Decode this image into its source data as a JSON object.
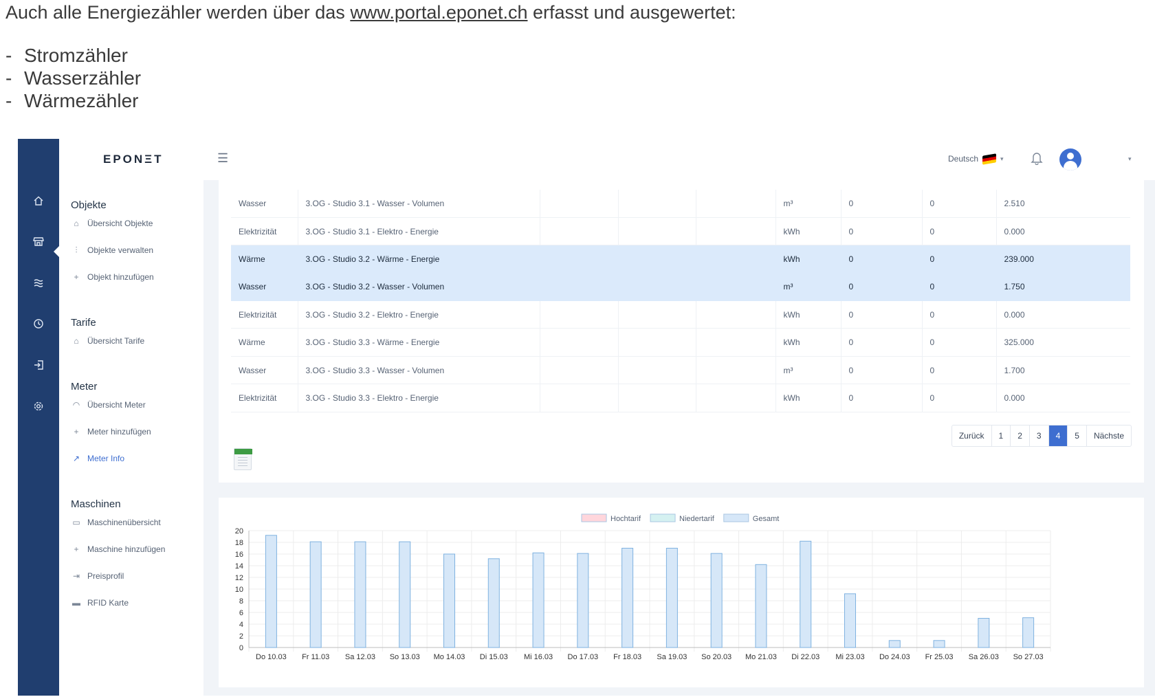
{
  "intro": {
    "text_before": "Auch alle Energiezähler werden über das ",
    "link": "www.portal.eponet.ch",
    "text_after": " erfasst und ausgewertet:",
    "bullets": [
      "Stromzähler",
      "Wasserzähler",
      "Wärmezähler"
    ],
    "dash": "-"
  },
  "brand": {
    "logo": "EPONΞT"
  },
  "topbar": {
    "language": "Deutsch"
  },
  "sidebar": {
    "objekte": {
      "title": "Objekte",
      "items": [
        "Übersicht Objekte",
        "Objekte verwalten",
        "Objekt hinzufügen"
      ]
    },
    "tarife": {
      "title": "Tarife",
      "items": [
        "Übersicht Tarife"
      ]
    },
    "meter": {
      "title": "Meter",
      "items": [
        "Übersicht Meter",
        "Meter hinzufügen",
        "Meter Info"
      ]
    },
    "maschinen": {
      "title": "Maschinen",
      "items": [
        "Maschinenübersicht",
        "Maschine hinzufügen",
        "Preisprofil",
        "RFID Karte"
      ]
    }
  },
  "table": {
    "rows": [
      {
        "type": "Wasser",
        "name": "3.OG - Studio 3.1 - Wasser - Volumen",
        "unit": "m³",
        "v1": "0",
        "v2": "0",
        "v3": "2.510",
        "highlight": false
      },
      {
        "type": "Elektrizität",
        "name": "3.OG - Studio 3.1 - Elektro - Energie",
        "unit": "kWh",
        "v1": "0",
        "v2": "0",
        "v3": "0.000",
        "highlight": false
      },
      {
        "type": "Wärme",
        "name": "3.OG - Studio 3.2 - Wärme - Energie",
        "unit": "kWh",
        "v1": "0",
        "v2": "0",
        "v3": "239.000",
        "highlight": true
      },
      {
        "type": "Wasser",
        "name": "3.OG - Studio 3.2 - Wasser - Volumen",
        "unit": "m³",
        "v1": "0",
        "v2": "0",
        "v3": "1.750",
        "highlight": true
      },
      {
        "type": "Elektrizität",
        "name": "3.OG - Studio 3.2 - Elektro - Energie",
        "unit": "kWh",
        "v1": "0",
        "v2": "0",
        "v3": "0.000",
        "highlight": false
      },
      {
        "type": "Wärme",
        "name": "3.OG - Studio 3.3 - Wärme - Energie",
        "unit": "kWh",
        "v1": "0",
        "v2": "0",
        "v3": "325.000",
        "highlight": false
      },
      {
        "type": "Wasser",
        "name": "3.OG - Studio 3.3 - Wasser - Volumen",
        "unit": "m³",
        "v1": "0",
        "v2": "0",
        "v3": "1.700",
        "highlight": false
      },
      {
        "type": "Elektrizität",
        "name": "3.OG - Studio 3.3 - Elektro - Energie",
        "unit": "kWh",
        "v1": "0",
        "v2": "0",
        "v3": "0.000",
        "highlight": false
      }
    ]
  },
  "pagination": {
    "prev": "Zurück",
    "pages": [
      "1",
      "2",
      "3",
      "4",
      "5"
    ],
    "active_page": "4",
    "next": "Nächste"
  },
  "icons": {
    "home": "home-icon",
    "store": "store-icon",
    "waves": "waves-icon",
    "clock": "clock-icon",
    "login": "login-icon",
    "settings": "gear-icon"
  },
  "colors": {
    "rail": "#203e6f",
    "accent": "#3e6ed0",
    "highlight_row": "#dbeafb",
    "bar_fill": "#d6e7f8",
    "bar_stroke": "#7fb2e0"
  },
  "chart_data": {
    "type": "bar",
    "legend": [
      "Hochtarif",
      "Niedertarif",
      "Gesamt"
    ],
    "legend_position": "top",
    "categories": [
      "Do 10.03",
      "Fr 11.03",
      "Sa 12.03",
      "So 13.03",
      "Mo 14.03",
      "Di 15.03",
      "Mi 16.03",
      "Do 17.03",
      "Fr 18.03",
      "Sa 19.03",
      "So 20.03",
      "Mo 21.03",
      "Di 22.03",
      "Mi 23.03",
      "Do 24.03",
      "Fr 25.03",
      "Sa 26.03",
      "So 27.03"
    ],
    "series": [
      {
        "name": "Hochtarif",
        "values": [
          0,
          0,
          0,
          0,
          0,
          0,
          0,
          0,
          0,
          0,
          0,
          0,
          0,
          0,
          0,
          0,
          0,
          0
        ],
        "color": "#ffd6dc"
      },
      {
        "name": "Niedertarif",
        "values": [
          0,
          0,
          0,
          0,
          0,
          0,
          0,
          0,
          0,
          0,
          0,
          0,
          0,
          0,
          0,
          0,
          0,
          0
        ],
        "color": "#d5f1f1"
      },
      {
        "name": "Gesamt",
        "values": [
          19.2,
          18.1,
          18.1,
          18.1,
          16.0,
          15.2,
          16.2,
          16.1,
          17.0,
          17.0,
          16.1,
          14.2,
          18.2,
          9.2,
          1.2,
          1.2,
          5.0,
          5.1
        ],
        "color": "#d6e7f8"
      }
    ],
    "yticks": [
      "0",
      "2",
      "4",
      "6",
      "8",
      "10",
      "12",
      "14",
      "16",
      "18",
      "20"
    ],
    "ylim": [
      0,
      20
    ],
    "grid": true
  }
}
